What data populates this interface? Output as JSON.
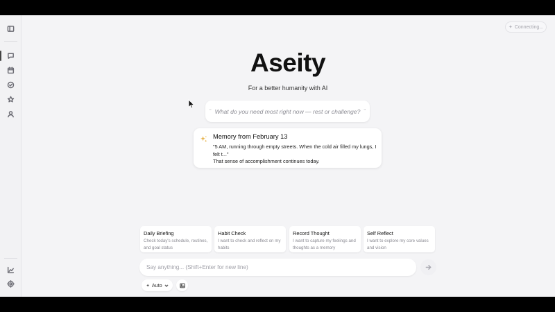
{
  "status": {
    "label": "Connecting...",
    "icon": "sparkle-icon"
  },
  "sidebar": {
    "top": [
      {
        "name": "sidebar-toggle-icon"
      }
    ],
    "nav": [
      {
        "name": "chat-icon",
        "active": true
      },
      {
        "name": "calendar-icon",
        "active": false
      },
      {
        "name": "check-circle-icon",
        "active": false
      },
      {
        "name": "star-icon",
        "active": false
      },
      {
        "name": "user-icon",
        "active": false
      }
    ],
    "bottom": [
      {
        "name": "chart-icon"
      },
      {
        "name": "settings-icon"
      }
    ]
  },
  "hero": {
    "title": "Aseity",
    "subtitle": "For a better humanity with AI"
  },
  "prompt": {
    "text": "What do you need most right now — rest or challenge?"
  },
  "memory": {
    "title": "Memory from February 13",
    "quote": "\"5 AM, running through empty streets. When the cold air filled my lungs, I felt t...\"",
    "footer": "That sense of accomplishment continues today."
  },
  "quick_actions": [
    {
      "title": "Daily Briefing",
      "desc": "Check today's schedule, routines, and goal status"
    },
    {
      "title": "Habit Check",
      "desc": "I want to check and reflect on my habits"
    },
    {
      "title": "Record Thought",
      "desc": "I want to capture my feelings and thoughts as a memory"
    },
    {
      "title": "Self Reflect",
      "desc": "I want to explore my core values and vision"
    }
  ],
  "composer": {
    "placeholder": "Say anything... (Shift+Enter for new line)",
    "mode_label": "Auto"
  }
}
